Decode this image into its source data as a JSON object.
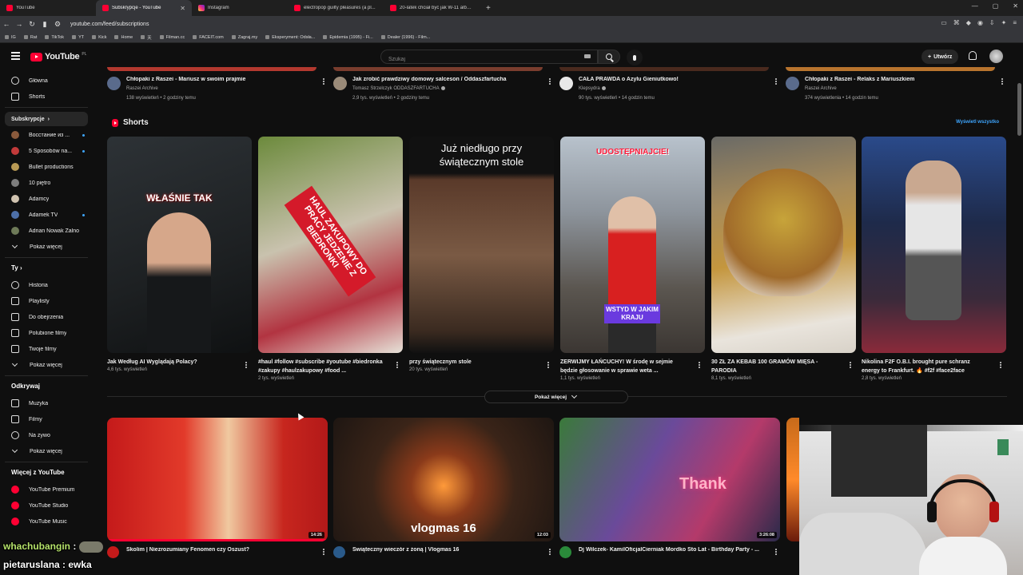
{
  "browser": {
    "tabs": [
      {
        "label": "YouTube",
        "fav": "yt"
      },
      {
        "label": "Subskrypcje - YouTube",
        "fav": "yt",
        "active": true
      },
      {
        "label": "Instagram",
        "fav": "ig"
      },
      {
        "label": "electropop guilty pleasures (a pl...",
        "fav": "yt"
      },
      {
        "label": "20-latek chciał być jak W-11 albo...",
        "fav": "yt"
      }
    ],
    "new_tab": "+",
    "url": "youtube.com/feed/subscriptions",
    "bookmarks": [
      "IG",
      "Rat",
      "TikTok",
      "YT",
      "Kick",
      "Home",
      "天",
      "Filman.cc",
      "FACEIT.com",
      "Zagraj.my",
      "Eksperyment: Odsła...",
      "Epidemia (1995) - Fi...",
      "Dealer (1996) - Film..."
    ]
  },
  "header": {
    "logo": "YouTube",
    "country": "PL",
    "search_placeholder": "Szukaj",
    "create_label": "Utwórz"
  },
  "sidebar": {
    "main": [
      {
        "label": "Główna",
        "icon": "home-icon"
      },
      {
        "label": "Shorts",
        "icon": "shorts-icon"
      }
    ],
    "subs_header": "Subskrypcje",
    "subs": [
      {
        "label": "Восстание из ...",
        "color": "#8a5a3c",
        "live": true
      },
      {
        "label": "5 Sposobów na...",
        "color": "#c23a3a",
        "live": true
      },
      {
        "label": "Bullet productions",
        "color": "#b99a55",
        "live": false
      },
      {
        "label": "10 piętro",
        "color": "#7d7d7d",
        "live": false
      },
      {
        "label": "Adamcy",
        "color": "#d0c3b0",
        "live": false
      },
      {
        "label": "Adamek TV",
        "color": "#4d6fa8",
        "live": true
      },
      {
        "label": "Adrian Nowak Żalno",
        "color": "#6e7a58",
        "live": false
      }
    ],
    "subs_more": "Pokaż więcej",
    "you_header": "Ty",
    "you": [
      {
        "label": "Historia",
        "icon": "history-icon"
      },
      {
        "label": "Playlisty",
        "icon": "playlist-icon"
      },
      {
        "label": "Do obejrzenia",
        "icon": "watch-later-icon"
      },
      {
        "label": "Polubione filmy",
        "icon": "like-icon"
      },
      {
        "label": "Twoje filmy",
        "icon": "your-videos-icon"
      }
    ],
    "you_more": "Pokaż więcej",
    "explore_header": "Odkrywaj",
    "explore": [
      {
        "label": "Muzyka",
        "icon": "music-icon"
      },
      {
        "label": "Filmy",
        "icon": "movies-icon"
      },
      {
        "label": "Na żywo",
        "icon": "live-icon"
      }
    ],
    "explore_more": "Pokaż więcej",
    "more_header": "Więcej z YouTube",
    "more": [
      {
        "label": "YouTube Premium",
        "icon": "yt-premium-icon"
      },
      {
        "label": "YouTube Studio",
        "icon": "yt-studio-icon"
      },
      {
        "label": "YouTube Music",
        "icon": "yt-music-icon"
      }
    ]
  },
  "top_videos": [
    {
      "title": "Chłopaki z Raszei - Mariusz w swoim prajmie",
      "channel": "Raszei Archive",
      "meta": "138 wyświetleń • 2 godziny temu",
      "verified": false,
      "strip": "#b3392f",
      "avatar": "#5a6b8c"
    },
    {
      "title": "Jak zrobić prawdziwy domowy salceson / Oddaszfartucha",
      "channel": "Tomasz Strzelczyk ODDASZFARTUCHA",
      "meta": "2,9 tys. wyświetleń • 2 godziny temu",
      "verified": true,
      "strip": "#7a3d2e",
      "avatar": "#9a8a78"
    },
    {
      "title": "CAŁA PRAWDA o Azylu Gieniutkowo!",
      "channel": "Klepsydra",
      "meta": "90 tys. wyświetleń • 14 godzin temu",
      "verified": true,
      "strip": "#4a2a1e",
      "avatar": "#e8e8e8"
    },
    {
      "title": "Chłopaki z Raszei - Relaks z Mariuszkiem",
      "channel": "Raszei Archive",
      "meta": "374 wyświetlenia • 14 godzin temu",
      "verified": false,
      "strip": "#b8742e",
      "avatar": "#5a6b8c"
    }
  ],
  "shorts": {
    "title": "Shorts",
    "view_all": "Wyświetl wszystko",
    "items": [
      {
        "title": "Jak Według AI Wyglądają Polacy?",
        "views": "4,6 tys. wyświetleń",
        "overlay": "WŁAŚNIE TAK",
        "bg": "linear-gradient(160deg,#2d3236 0%,#1d2022 60%,#0f1112 100%)"
      },
      {
        "title": "#haul #follow #subscribe #youtube #biedronka #zakupy #haulzakupowy #food ...",
        "views": "2 tys. wyświetleń",
        "overlay": "HAUL ZAKUPOWY DO PRACY JEDZENIE Z BIEDRONKI",
        "bg": "linear-gradient(160deg,#6c8a3c 0%,#c9c2ae 45%,#b23441 75%,#e6e2d8 100%)"
      },
      {
        "title": "przy świątecznym stole",
        "views": "20 tys. wyświetleń",
        "overlay": "Już niedługo przy świątecznym stole",
        "bg": "linear-gradient(180deg,#111 0%,#111 17%,#5a3a2a 20%,#7a5a44 55%,#3a2a20 90%,#111 100%)"
      },
      {
        "title": "ZERWIJMY ŁAŃCUCHY! W środę w sejmie będzie głosowanie w sprawie weta ...",
        "views": "1,1 tys. wyświetleń",
        "overlay": "UDOSTĘPNIAJCIE!",
        "overlay2": "WSTYD W JAKIM KRAJU",
        "bg": "linear-gradient(180deg,#b8c2cc 0%,#8d949c 35%,#5b5650 70%,#3b3632 100%)"
      },
      {
        "title": "30 ZŁ ZA KEBAB 100 GRAMÓW MIĘSA - PARODIA",
        "views": "8,1 tys. wyświetleń",
        "overlay": "",
        "bg": "linear-gradient(170deg,#6a6a66 0%,#a78b5a 30%,#c4963e 55%,#e9e4dc 85%,#d8d2c8 100%)"
      },
      {
        "title": "Nikolina F2F O.B.I. brought pure schranz energy to Frankfurt. 🔥 #f2f #face2face",
        "views": "2,8 tys. wyświetleń",
        "overlay": "",
        "bg": "linear-gradient(180deg,#2a4a8a 0%,#1e2a4a 40%,#3a2a3a 75%,#8a2a3a 100%)"
      }
    ],
    "show_more": "Pokaż więcej"
  },
  "big_videos": [
    {
      "title": "Skolim | Niezrozumiany Fenomen czy Oszust?",
      "duration": "14:26",
      "bg": "linear-gradient(90deg,#c41a1a 0%,#e23a2a 35%,#f0c9a0 55%,#c7261e 80%,#b31919 100%)",
      "avatar": "#c41a1a",
      "progress_pct": 100
    },
    {
      "title": "Świąteczny wieczór z żoną | Vlogmas 16",
      "duration": "12:03",
      "overlay": "vlogmas 16",
      "bg": "radial-gradient(circle at 50% 55%,#ff9a3a 0%,#8a3a1a 25%,#3a2418 55%,#1e1612 100%)",
      "avatar": "#2a5a8a",
      "progress_pct": 0
    },
    {
      "title": "Dj Wilczek- KamilOficjalCierniak Mordko Sto Lat - Birthday Party - ...",
      "duration": "3:26:08",
      "overlay": "Thank",
      "bg": "linear-gradient(120deg,#3a7a3a 0%,#6a4a9a 40%,#b43a6a 70%,#2a2a4a 100%)",
      "avatar": "#2a8a3a",
      "progress_pct": 0
    }
  ],
  "stream_chat": [
    {
      "user": "whachubangin",
      "text": ""
    },
    {
      "user": "pietaruslana",
      "text": "ewka"
    }
  ]
}
